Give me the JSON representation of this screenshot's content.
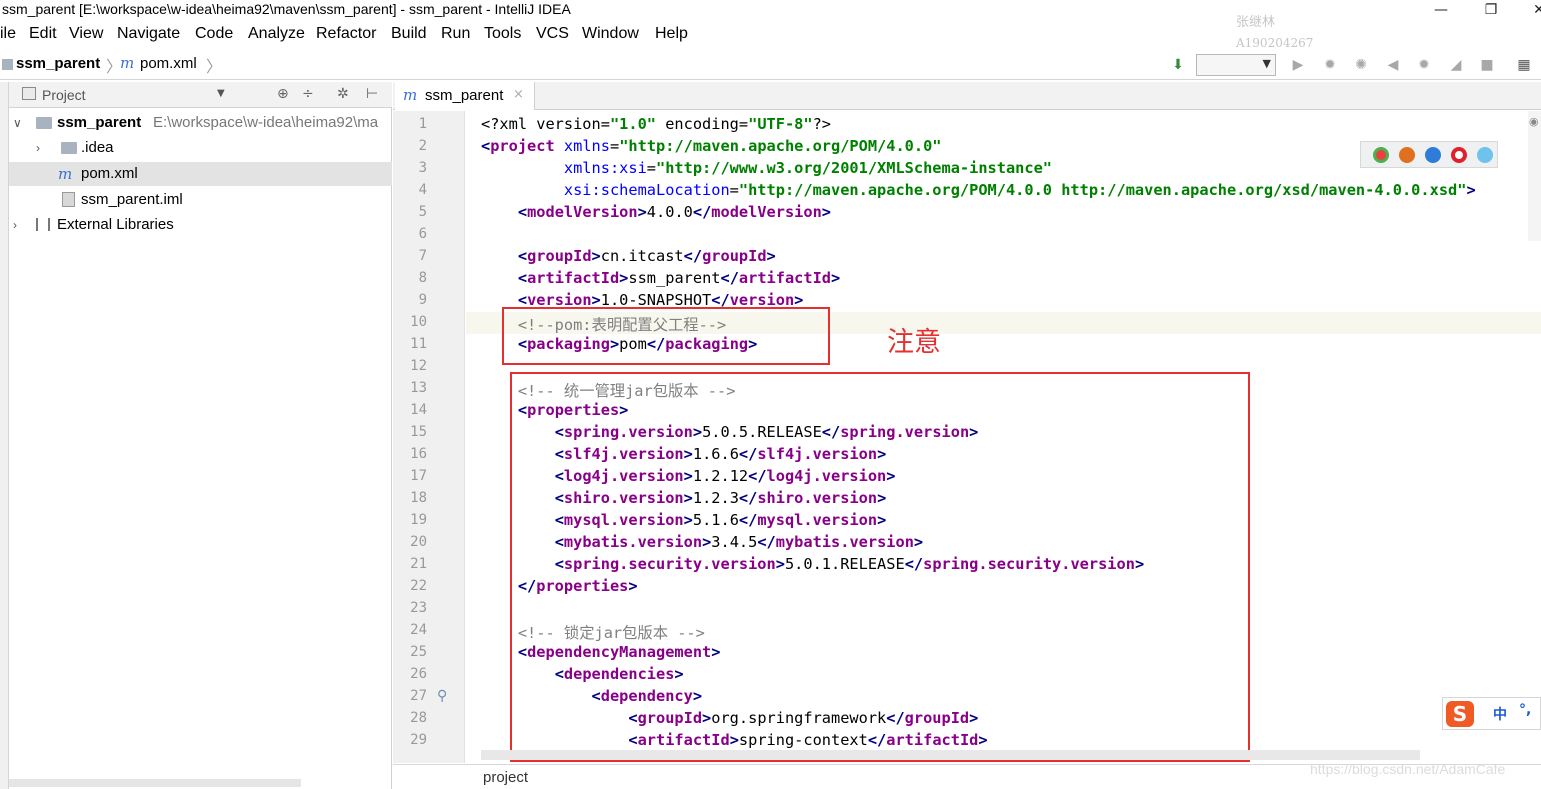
{
  "window": {
    "title": "ssm_parent [E:\\workspace\\w-idea\\heima92\\maven\\ssm_parent] - ssm_parent - IntelliJ IDEA",
    "watermark_name": "张继林",
    "watermark_id": "A190204267",
    "minimize": "—",
    "restore": "❐",
    "close": "✕"
  },
  "menu": [
    "ile",
    "Edit",
    "View",
    "Navigate",
    "Code",
    "Analyze",
    "Refactor",
    "Build",
    "Run",
    "Tools",
    "VCS",
    "Window",
    "Help"
  ],
  "navbar": {
    "project": "ssm_parent",
    "file": "pom.xml"
  },
  "project_panel": {
    "header": "Project",
    "tree": [
      {
        "label": "ssm_parent",
        "path": "E:\\workspace\\w-idea\\heima92\\ma",
        "kind": "module"
      },
      {
        "label": ".idea",
        "kind": "folder"
      },
      {
        "label": "pom.xml",
        "kind": "maven",
        "selected": true
      },
      {
        "label": "ssm_parent.iml",
        "kind": "file"
      },
      {
        "label": "External Libraries",
        "kind": "library"
      }
    ]
  },
  "editor": {
    "tab_label": "ssm_parent",
    "line_numbers": [
      "1",
      "2",
      "3",
      "4",
      "5",
      "6",
      "7",
      "8",
      "9",
      "10",
      "11",
      "12",
      "13",
      "14",
      "15",
      "16",
      "17",
      "18",
      "19",
      "20",
      "21",
      "22",
      "23",
      "24",
      "25",
      "26",
      "27",
      "28",
      "29"
    ],
    "annotation": "注意"
  },
  "status": {
    "label": "project",
    "csdn_watermark": "https://blog.csdn.net/AdamCafe"
  },
  "ime": {
    "mode": "中",
    "punct": "°,"
  },
  "colors": {
    "tag": "#880088",
    "attr_value": "#008000",
    "comment": "#808080",
    "highlight_box": "#e53030"
  }
}
